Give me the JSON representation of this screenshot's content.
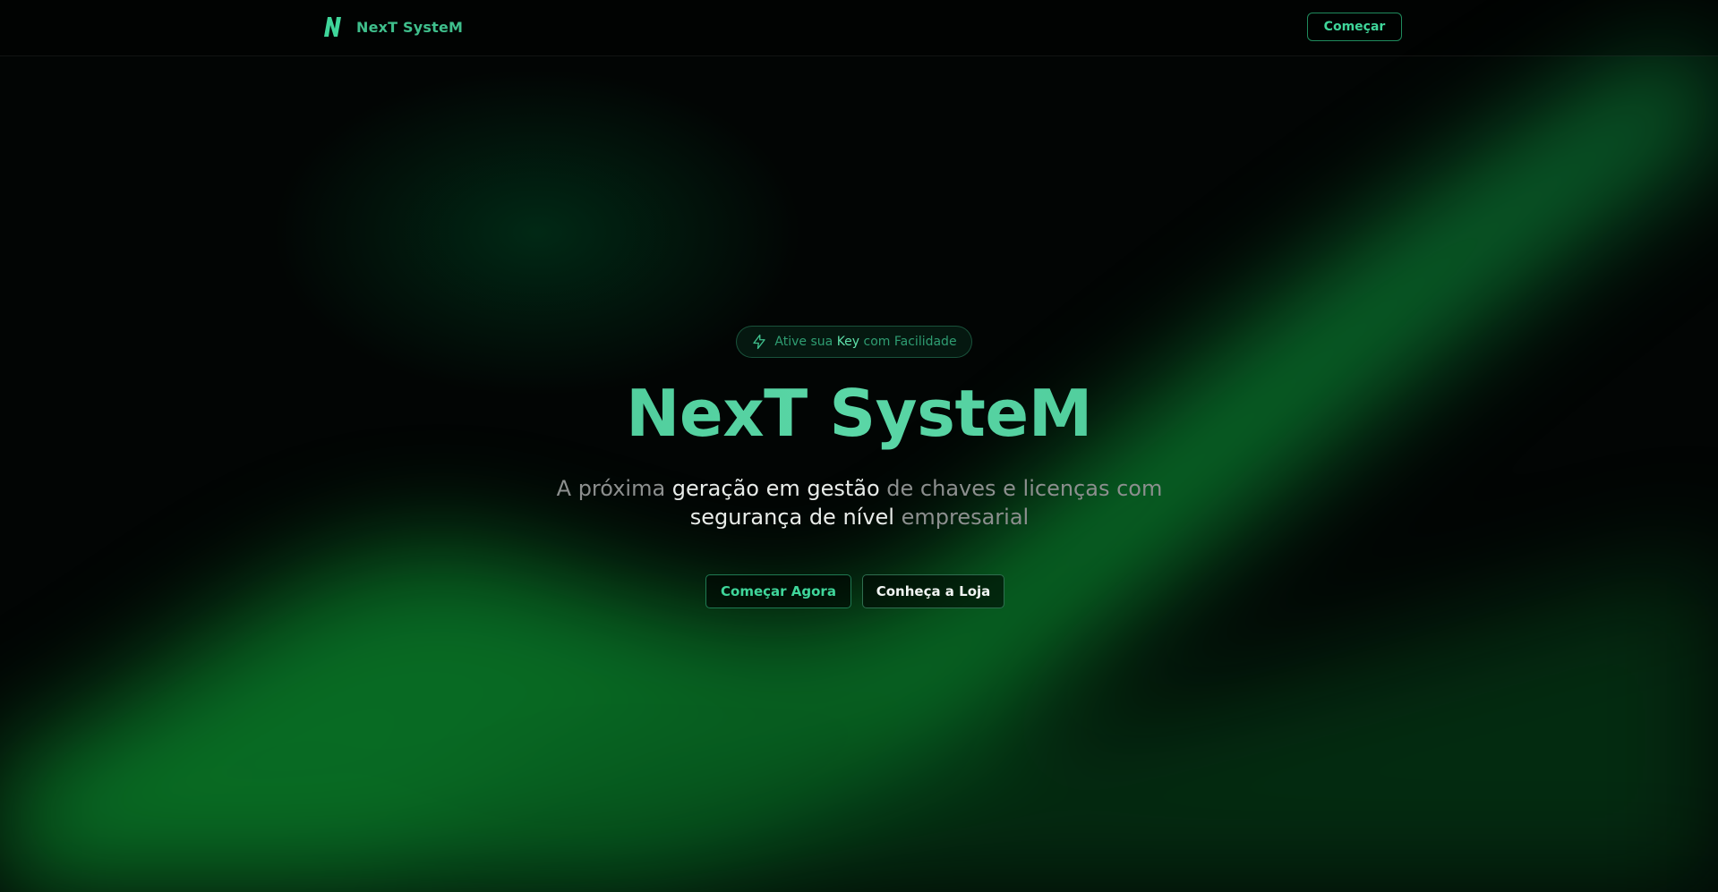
{
  "navbar": {
    "brand_name": "NexT SysteM",
    "cta_label": "Começar"
  },
  "hero": {
    "badge": {
      "prefix": "Ative sua ",
      "highlight": "Key",
      "suffix": " com Facilidade"
    },
    "title": "NexT SysteM",
    "subtitle": {
      "part1": "A próxima ",
      "part2": "geração em gestão",
      "part3": " de chaves e licenças com ",
      "part4": "segurança de nível",
      "part5": " empresarial"
    },
    "primary_button": "Começar Agora",
    "secondary_button": "Conheça a Loja"
  },
  "colors": {
    "accent": "#3fbf8c",
    "accent_bright": "#3fd69a",
    "background": "#020504",
    "glow": "#0a8a2e"
  },
  "icons": {
    "brand": "lightning-n-logo",
    "badge": "zap-icon"
  }
}
